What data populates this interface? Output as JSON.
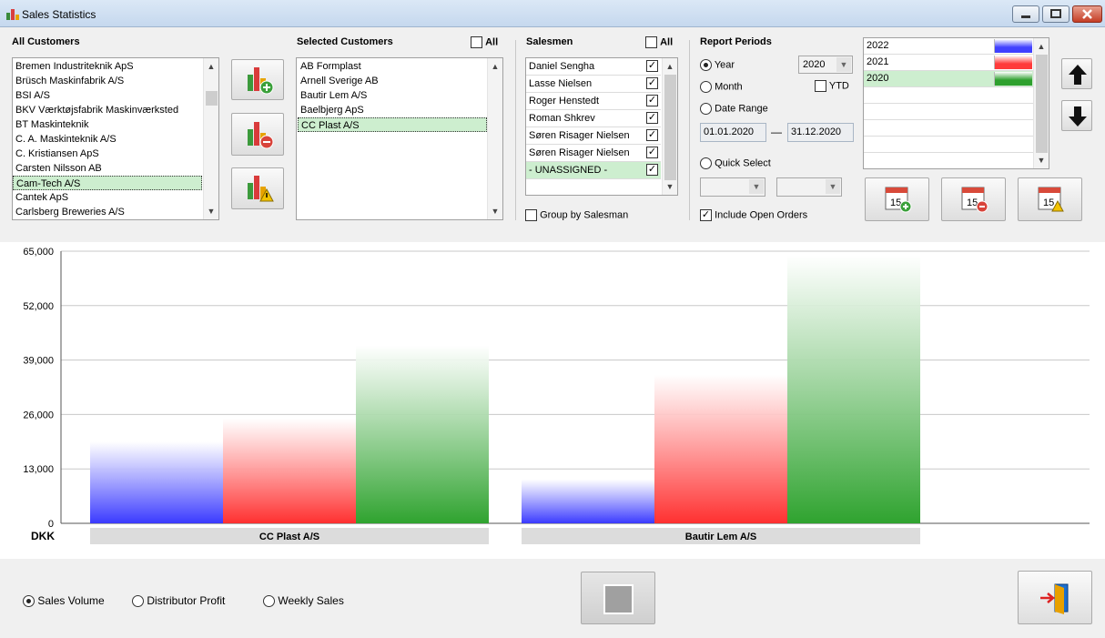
{
  "window": {
    "title": "Sales Statistics"
  },
  "all_customers": {
    "label": "All Customers",
    "items": [
      "Bremen Industriteknik ApS",
      "Brüsch Maskinfabrik A/S",
      "BSI A/S",
      "BKV Værktøjsfabrik Maskinværksted",
      "BT Maskinteknik",
      "C. A. Maskinteknik A/S",
      "C. Kristiansen ApS",
      "Carsten Nilsson AB",
      "Cam-Tech A/S",
      "Cantek ApS",
      "Carlsberg Breweries A/S"
    ],
    "selected_index": 8
  },
  "selected_customers": {
    "label": "Selected Customers",
    "all_label": "All",
    "items": [
      "AB Formplast",
      "Arnell Sverige AB",
      "Bautir Lem A/S",
      "Baelbjerg ApS",
      "CC Plast A/S"
    ],
    "selected_index": 4
  },
  "salesmen": {
    "label": "Salesmen",
    "all_label": "All",
    "items": [
      {
        "name": "Daniel Sengha",
        "checked": true
      },
      {
        "name": "Lasse Nielsen",
        "checked": true
      },
      {
        "name": "Roger Henstedt",
        "checked": true
      },
      {
        "name": "Roman Shkrev",
        "checked": true
      },
      {
        "name": "Søren Risager Nielsen",
        "checked": true
      },
      {
        "name": "Søren Risager Nielsen",
        "checked": true
      },
      {
        "name": "- UNASSIGNED -",
        "checked": true,
        "selected": true
      }
    ],
    "group_by_label": "Group by Salesman",
    "group_by_checked": false
  },
  "report_periods": {
    "label": "Report Periods",
    "options": {
      "year": "Year",
      "month": "Month",
      "date_range": "Date Range",
      "quick_select": "Quick Select"
    },
    "selected": "year",
    "year_value": "2020",
    "ytd_label": "YTD",
    "ytd_checked": false,
    "date_from": "01.01.2020",
    "date_to": "31.12.2020",
    "date_sep": "—",
    "include_open_orders_label": "Include Open Orders",
    "include_open_orders_checked": true
  },
  "periods_list": [
    {
      "label": "2022",
      "color": "#4040ff"
    },
    {
      "label": "2021",
      "color": "#ff3b3b"
    },
    {
      "label": "2020",
      "color": "#2ea02e",
      "selected": true
    }
  ],
  "bottom": {
    "options": [
      "Sales Volume",
      "Distributor Profit",
      "Weekly Sales"
    ],
    "selected": 0
  },
  "colors": {
    "selection": "#cdeecf",
    "series_2022": "#3a3aff",
    "series_2021": "#ff3030",
    "series_2020": "#2fa32f"
  },
  "chart_data": {
    "type": "bar",
    "currency_label": "DKK",
    "categories": [
      "CC Plast A/S",
      "Bautir Lem A/S"
    ],
    "series": [
      {
        "name": "2022",
        "values": [
          19500,
          10500
        ]
      },
      {
        "name": "2021",
        "values": [
          25000,
          35500
        ]
      },
      {
        "name": "2020",
        "values": [
          42500,
          64000
        ]
      }
    ],
    "ylim": [
      0,
      65000
    ],
    "yticks": [
      "0",
      "13,000",
      "26,000",
      "39,000",
      "52,000",
      "65,000"
    ],
    "grid": true
  }
}
